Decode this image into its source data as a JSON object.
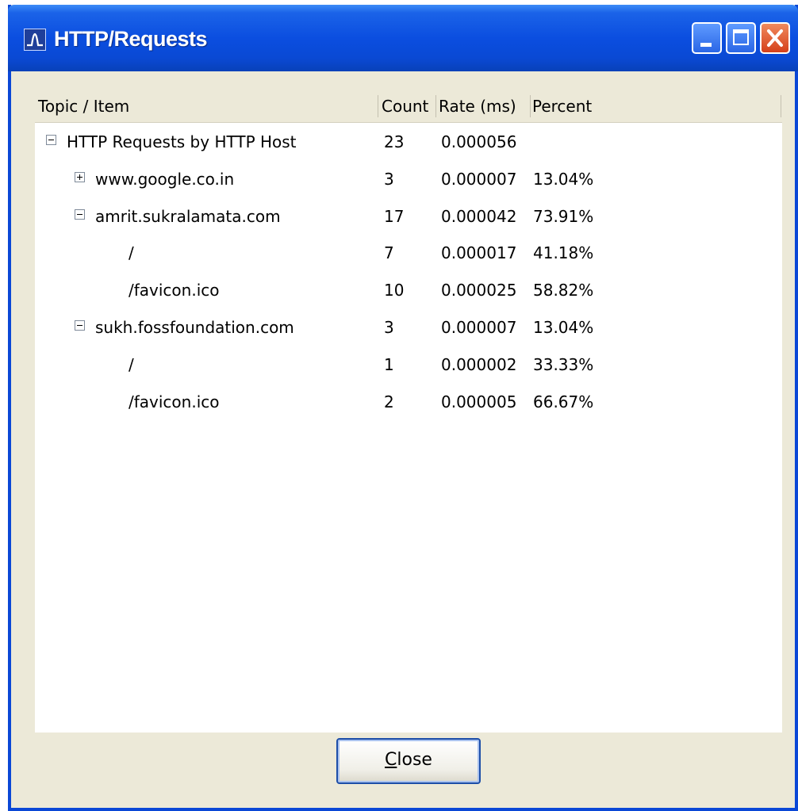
{
  "window": {
    "title": "HTTP/Requests",
    "app_icon": "waveform-icon",
    "controls": [
      "minimize-icon",
      "maximize-icon",
      "close-icon"
    ]
  },
  "table": {
    "columns": [
      "Topic / Item",
      "Count",
      "Rate (ms)",
      "Percent"
    ],
    "rows": [
      {
        "level": 0,
        "toggle": "collapse",
        "topic": "HTTP Requests by HTTP Host",
        "count": "23",
        "rate": "0.000056",
        "percent": ""
      },
      {
        "level": 1,
        "toggle": "expand",
        "topic": "www.google.co.in",
        "count": "3",
        "rate": "0.000007",
        "percent": "13.04%"
      },
      {
        "level": 1,
        "toggle": "collapse",
        "topic": "amrit.sukralamata.com",
        "count": "17",
        "rate": "0.000042",
        "percent": "73.91%"
      },
      {
        "level": 2,
        "toggle": "",
        "topic": "/",
        "count": "7",
        "rate": "0.000017",
        "percent": "41.18%"
      },
      {
        "level": 2,
        "toggle": "",
        "topic": "/favicon.ico",
        "count": "10",
        "rate": "0.000025",
        "percent": "58.82%"
      },
      {
        "level": 1,
        "toggle": "collapse",
        "topic": "sukh.fossfoundation.com",
        "count": "3",
        "rate": "0.000007",
        "percent": "13.04%"
      },
      {
        "level": 2,
        "toggle": "",
        "topic": "/",
        "count": "1",
        "rate": "0.000002",
        "percent": "33.33%"
      },
      {
        "level": 2,
        "toggle": "",
        "topic": "/favicon.ico",
        "count": "2",
        "rate": "0.000005",
        "percent": "66.67%"
      }
    ]
  },
  "buttons": {
    "close_mnemonic": "C",
    "close_rest": "lose"
  },
  "colors": {
    "titlebar": "#0a49d4",
    "window_bg": "#ece9d8",
    "close_caption": "#d5401a"
  }
}
